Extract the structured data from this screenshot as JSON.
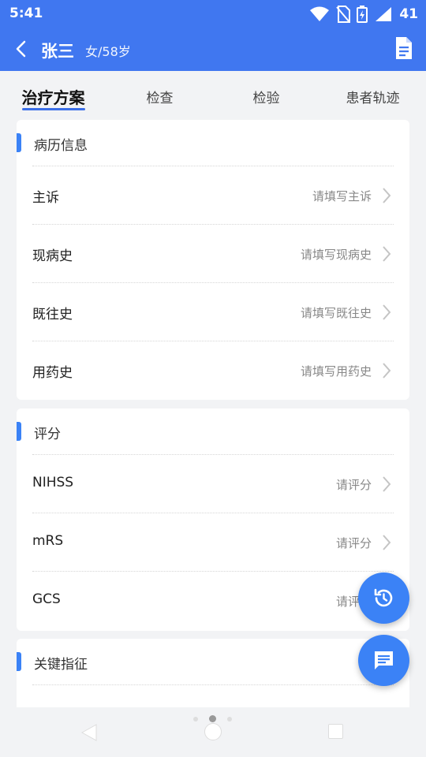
{
  "status": {
    "time": "5:41",
    "battery_text": "41"
  },
  "header": {
    "name": "张三",
    "info": "女/58岁"
  },
  "tabs": [
    {
      "label": "治疗方案",
      "active": true
    },
    {
      "label": "检查"
    },
    {
      "label": "检验"
    },
    {
      "label": "患者轨迹"
    }
  ],
  "sections": {
    "history": {
      "title": "病历信息",
      "rows": [
        {
          "label": "主诉",
          "hint": "请填写主诉"
        },
        {
          "label": "现病史",
          "hint": "请填写现病史"
        },
        {
          "label": "既往史",
          "hint": "请填写既往史"
        },
        {
          "label": "用药史",
          "hint": "请填写用药史"
        }
      ]
    },
    "score": {
      "title": "评分",
      "rows": [
        {
          "label": "NIHSS",
          "hint": "请评分"
        },
        {
          "label": "mRS",
          "hint": "请评分"
        },
        {
          "label": "GCS",
          "hint": "请评分"
        }
      ]
    },
    "vitals": {
      "title": "关键指征"
    }
  },
  "fabs": {
    "history_icon": "history-icon",
    "chat_icon": "chat-icon"
  },
  "colors": {
    "primary": "#4077f0",
    "accent": "#3b82f6",
    "background": "#f2f3f5"
  }
}
